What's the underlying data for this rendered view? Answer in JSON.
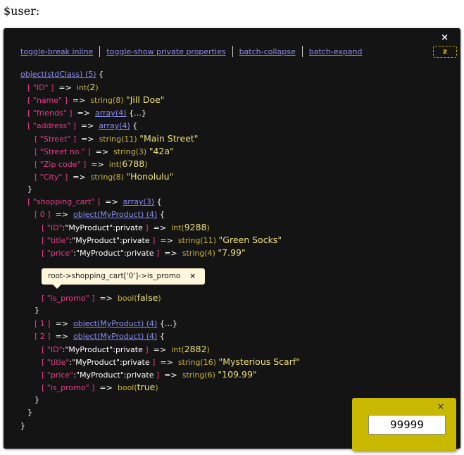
{
  "header": {
    "var_label": "$user:"
  },
  "panel": {
    "close_glyph": "×",
    "toolbar": {
      "toggle_break": "toggle-break inline",
      "toggle_private": "toggle-show private properties",
      "batch_collapse": "batch-collapse",
      "batch_expand": "batch-expand"
    },
    "z_button": "z"
  },
  "dump": {
    "root_type": "object(stdClass) (5)",
    "root_open": " {",
    "id_key": "[ \"ID\" ]",
    "id_type": "int(",
    "id_val": "2",
    "name_key": "[ \"name\" ]",
    "name_type": "string(8)",
    "name_val": "\"Jill Doe\"",
    "friends_key": "[ \"friends\" ]",
    "friends_type": "array(4)",
    "friends_tail": " {…}",
    "address_key": "[ \"address\" ]",
    "address_type": "array(4)",
    "street_key": "[ \"Street\" ]",
    "street_type": "string(11)",
    "street_val": "\"Main Street\"",
    "streetno_key": "[ \"Street no.\" ]",
    "streetno_type": "string(3)",
    "streetno_val": "\"42a\"",
    "zip_key": "[ \"Zip code\" ]",
    "zip_type": "int(",
    "zip_val": "6788",
    "city_key": "[ \"City\" ]",
    "city_type": "string(8)",
    "city_val": "\"Honolulu\"",
    "cart_key": "[ \"shopping_cart\" ]",
    "cart_type": "array(3)",
    "item0_key": "[ 0 ]",
    "item0_type": "object(MyProduct) (4)",
    "p0_id_key": "\"ID\"",
    "p0_id_type": "int(",
    "p0_id_val": "9288",
    "p0_title_key": "\"title\"",
    "p0_title_type": "string(11)",
    "p0_title_val": "\"Green Socks\"",
    "p0_price_key": "\"price\"",
    "p0_price_type": "string(4)",
    "p0_price_val": "\"7.99\"",
    "p0_promo_key": "[ \"is_promo\" ]",
    "p0_promo_type": "bool(",
    "p0_promo_val": "false",
    "item1_key": "[ 1 ]",
    "item1_type": "object(MyProduct) (4)",
    "item1_tail": " {…}",
    "item2_key": "[ 2 ]",
    "item2_type": "object(MyProduct) (4)",
    "p2_id_key": "\"ID\"",
    "p2_id_type": "int(",
    "p2_id_val": "2882",
    "p2_title_key": "\"title\"",
    "p2_title_type": "string(16)",
    "p2_title_val": "\"Mysterious Scarf\"",
    "p2_price_key": "\"price\"",
    "p2_price_type": "string(6)",
    "p2_price_val": "\"109.99\"",
    "p2_promo_key": "[ \"is_promo\" ]",
    "p2_promo_type": "bool(",
    "p2_promo_val": "true",
    "private_suffix": ":\"MyProduct\":private",
    "arrow": "=>",
    "close_paren": ")",
    "open_brace": " {",
    "close_brace": "}"
  },
  "tooltip": {
    "path": "root->shopping_cart['0']->is_promo",
    "close_glyph": "×"
  },
  "goto": {
    "close_glyph": "×",
    "value": "99999"
  }
}
